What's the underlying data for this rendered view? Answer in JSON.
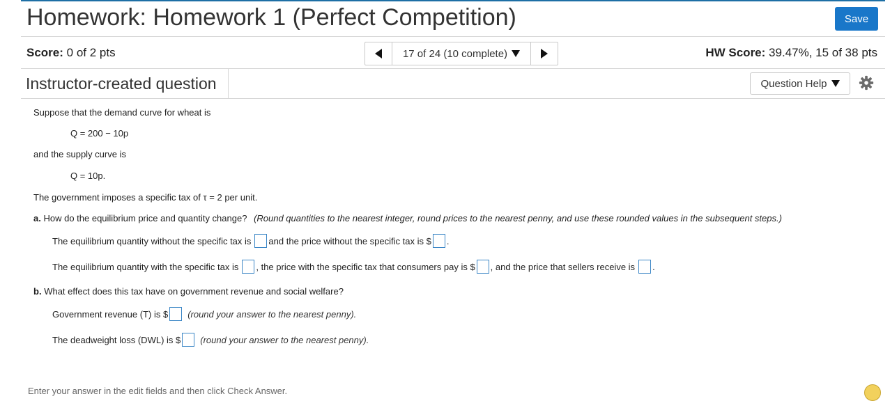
{
  "header": {
    "title": "Homework: Homework 1 (Perfect Competition)",
    "save_label": "Save"
  },
  "scorebar": {
    "score_label": "Score:",
    "score_value": "0 of 2 pts",
    "nav_position": "17 of 24 (10 complete)",
    "hw_score_label": "HW Score:",
    "hw_score_value": "39.47%, 15 of 38 pts"
  },
  "question_header": {
    "type_label": "Instructor-created question",
    "help_label": "Question Help"
  },
  "question": {
    "intro": "Suppose that the demand curve for wheat is",
    "demand_eq": "Q = 200 − 10p",
    "supply_intro": "and the supply curve is",
    "supply_eq": "Q = 10p.",
    "tax_text_pre": "The government imposes a specific tax of",
    "tax_symbol": "τ",
    "tax_text_post": "= 2 per unit.",
    "part_a_label": "a.",
    "part_a_text": "How do the equilibrium price and quantity change?",
    "part_a_hint": "(Round quantities to the nearest integer, round prices to the nearest penny, and use these rounded values in the subsequent steps.)",
    "a1_pre": "The equilibrium quantity without the specific tax is",
    "a1_mid": "and the price without the specific tax is $",
    "a1_end": ".",
    "a2_pre": "The equilibrium quantity with the specific tax is",
    "a2_mid1": ", the price with the specific tax that consumers pay is $",
    "a2_mid2": ", and the price that sellers receive is",
    "a2_end": ".",
    "part_b_label": "b.",
    "part_b_text": "What effect does this tax have on government revenue and social welfare?",
    "b1_pre": "Government revenue (T) is $",
    "b1_hint": "(round your answer to the nearest penny).",
    "b2_pre": "The deadweight loss (DWL) is $",
    "b2_hint": "(round your answer to the nearest penny)."
  },
  "footer": {
    "instruction": "Enter your answer in the edit fields and then click Check Answer."
  },
  "colors": {
    "accent": "#1977c9",
    "input_border": "#3b86c6"
  }
}
